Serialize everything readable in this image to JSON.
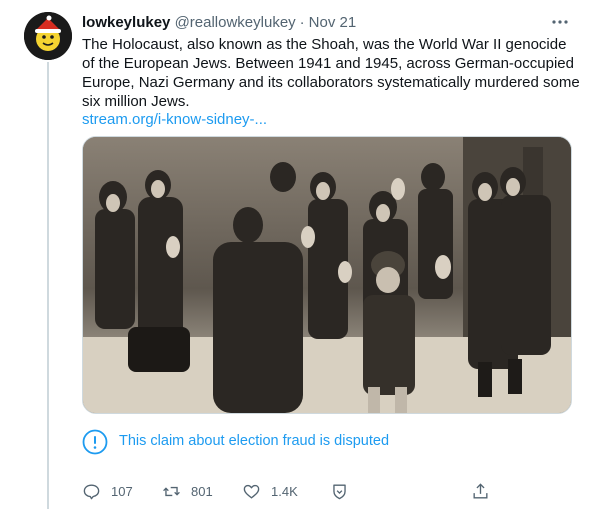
{
  "tweet": {
    "display_name": "lowkeylukey",
    "handle": "@reallowkeylukey",
    "separator": "·",
    "date": "Nov 21",
    "text": "The Holocaust, also known as the Shoah, was the World War II genocide of the European Jews. Between 1941 and 1945, across German-occupied Europe, Nazi Germany and its collaborators systematically murdered some six million Jews.",
    "link": "stream.org/i-know-sidney-..."
  },
  "notice": {
    "text": "This claim about election fraud is disputed",
    "icon": "exclamation-circle-icon"
  },
  "actions": {
    "replies": "107",
    "retweets": "801",
    "likes": "1.4K"
  },
  "colors": {
    "accent": "#1d9bf0",
    "secondary_text": "#536471",
    "border": "#cfd9de"
  }
}
